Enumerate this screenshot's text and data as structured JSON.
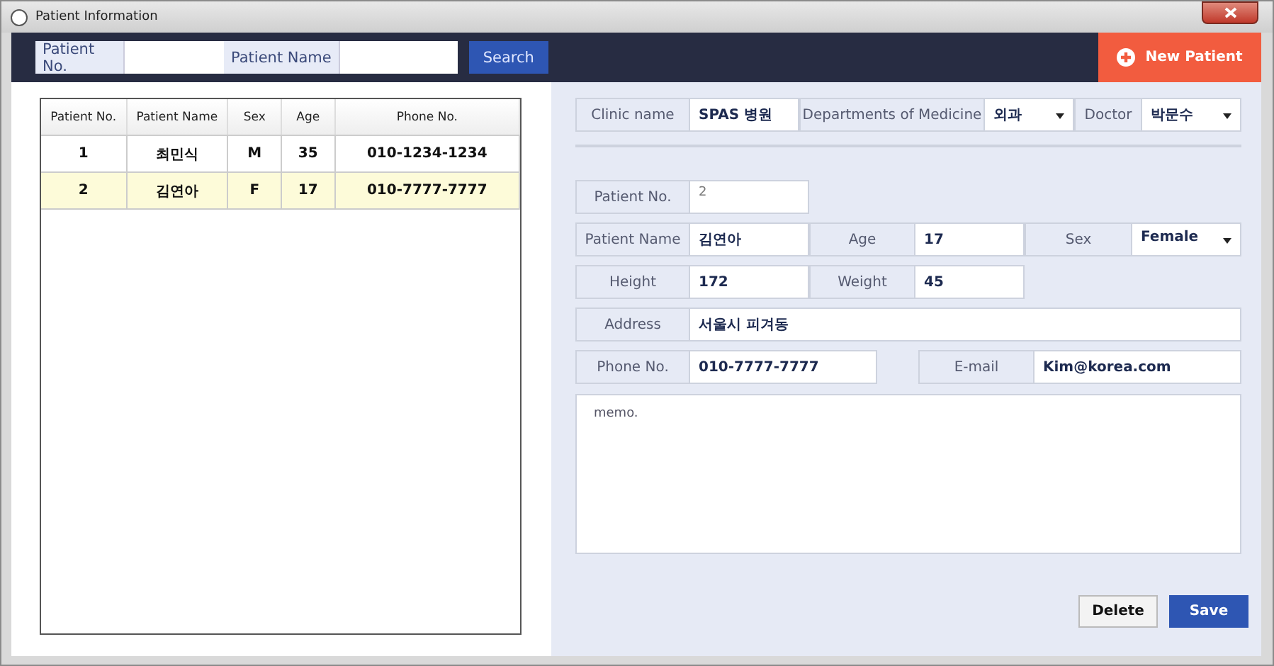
{
  "window": {
    "title": "Patient Information"
  },
  "search": {
    "fields": [
      {
        "label": "Patient No."
      },
      {
        "label": "Patient  Name"
      }
    ],
    "button": "Search"
  },
  "new_patient_button": "New Patient",
  "table": {
    "columns": [
      "Patient No.",
      "Patient Name",
      "Sex",
      "Age",
      "Phone No."
    ],
    "rows": [
      {
        "cells": [
          "1",
          "최민식",
          "M",
          "35",
          "010-1234-1234"
        ],
        "selected": false
      },
      {
        "cells": [
          "2",
          "김연아",
          "F",
          "17",
          "010-7777-7777"
        ],
        "selected": true
      }
    ]
  },
  "clinic": [
    {
      "label": "Clinic name",
      "value": "SPAS 병원",
      "kind": "text"
    },
    {
      "label": "Departments of Medicine",
      "value": "외과",
      "kind": "select"
    },
    {
      "label": "Doctor",
      "value": "박문수",
      "kind": "select"
    }
  ],
  "form_rows": [
    [
      {
        "label": "Patient No.",
        "value": "2",
        "kind": "plain"
      }
    ],
    [
      {
        "label": "Patient Name",
        "value": "김연아",
        "kind": "text"
      },
      {
        "label": "Age",
        "value": "17",
        "kind": "text"
      },
      {
        "label": "Sex",
        "value": "Female",
        "kind": "select"
      }
    ],
    [
      {
        "label": "Height",
        "value": "172",
        "kind": "text"
      },
      {
        "label": "Weight",
        "value": "45",
        "kind": "text"
      }
    ],
    [
      {
        "label": "Address",
        "value": "서울시 피겨동",
        "kind": "text"
      }
    ],
    [
      {
        "label": "Phone No.",
        "value": "010-7777-7777",
        "kind": "text"
      },
      {
        "label": "E-mail",
        "value": "Kim@korea.com",
        "kind": "text"
      }
    ]
  ],
  "memo": {
    "placeholder": "memo."
  },
  "buttons": [
    {
      "label": "Delete",
      "kind": "secondary"
    },
    {
      "label": "Save",
      "kind": "primary"
    }
  ]
}
